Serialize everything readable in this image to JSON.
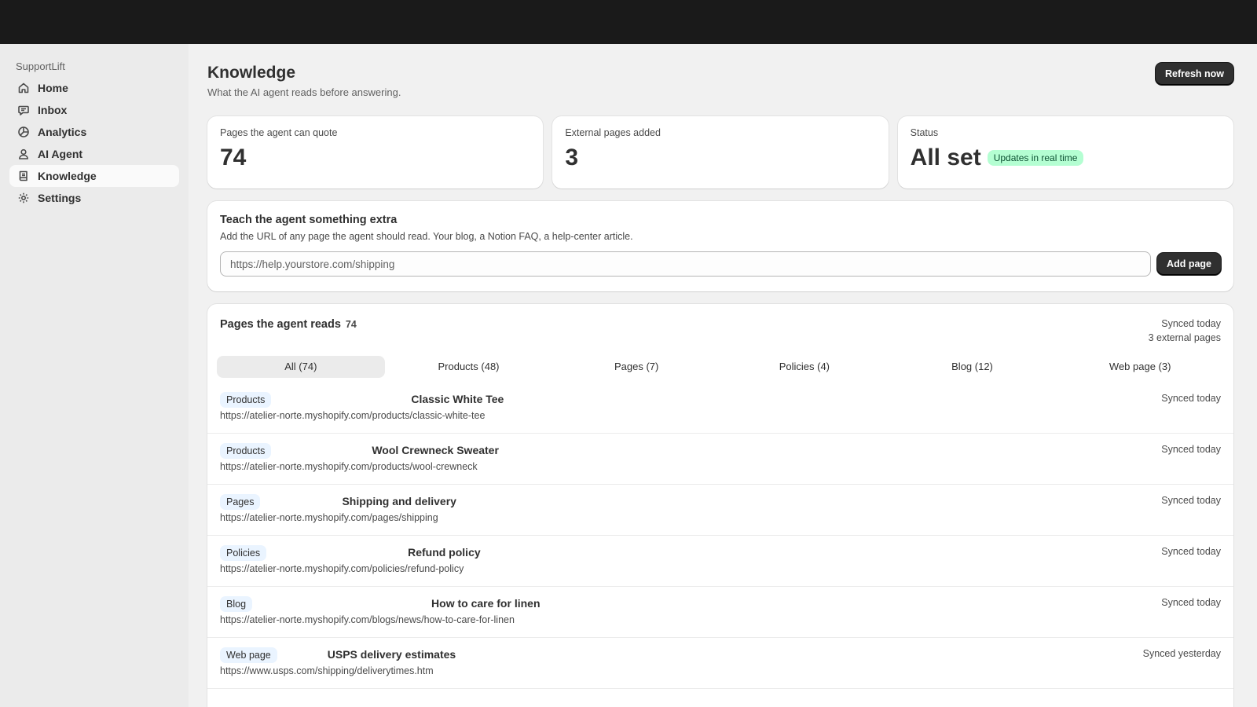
{
  "app": {
    "brand": "SupportLift"
  },
  "sidebar": {
    "items": [
      {
        "label": "Home",
        "icon": "home-icon",
        "active": false
      },
      {
        "label": "Inbox",
        "icon": "chat-icon",
        "active": false
      },
      {
        "label": "Analytics",
        "icon": "analytics-icon",
        "active": false
      },
      {
        "label": "AI Agent",
        "icon": "person-icon",
        "active": false
      },
      {
        "label": "Knowledge",
        "icon": "book-icon",
        "active": true
      },
      {
        "label": "Settings",
        "icon": "gear-icon",
        "active": false
      }
    ]
  },
  "header": {
    "title": "Knowledge",
    "subtitle": "What the AI agent reads before answering.",
    "refresh_label": "Refresh now"
  },
  "stats": {
    "quotable_label": "Pages the agent can quote",
    "quotable_value": "74",
    "external_label": "External pages added",
    "external_value": "3",
    "status_label": "Status",
    "status_value": "All set",
    "status_badge": "Updates in real time"
  },
  "teach": {
    "title": "Teach the agent something extra",
    "subtitle": "Add the URL of any page the agent should read. Your blog, a Notion FAQ, a help-center article.",
    "placeholder": "https://help.yourstore.com/shipping",
    "add_label": "Add page"
  },
  "pages_list": {
    "title": "Pages the agent reads",
    "count": "74",
    "synced": "Synced today",
    "external": "3 external pages",
    "tabs": [
      {
        "label": "All (74)",
        "active": true
      },
      {
        "label": "Products (48)",
        "active": false
      },
      {
        "label": "Pages (7)",
        "active": false
      },
      {
        "label": "Policies (4)",
        "active": false
      },
      {
        "label": "Blog (12)",
        "active": false
      },
      {
        "label": "Web page (3)",
        "active": false
      }
    ],
    "rows": [
      {
        "tag": "Products",
        "title": "Classic White Tee",
        "url": "https://atelier-norte.myshopify.com/products/classic-white-tee",
        "sync": "Synced today"
      },
      {
        "tag": "Products",
        "title": "Wool Crewneck Sweater",
        "url": "https://atelier-norte.myshopify.com/products/wool-crewneck",
        "sync": "Synced today"
      },
      {
        "tag": "Pages",
        "title": "Shipping and delivery",
        "url": "https://atelier-norte.myshopify.com/pages/shipping",
        "sync": "Synced today"
      },
      {
        "tag": "Policies",
        "title": "Refund policy",
        "url": "https://atelier-norte.myshopify.com/policies/refund-policy",
        "sync": "Synced today"
      },
      {
        "tag": "Blog",
        "title": "How to care for linen",
        "url": "https://atelier-norte.myshopify.com/blogs/news/how-to-care-for-linen",
        "sync": "Synced today"
      },
      {
        "tag": "Web page",
        "title": "USPS delivery estimates",
        "url": "https://www.usps.com/shipping/deliverytimes.htm",
        "sync": "Synced yesterday"
      }
    ]
  }
}
